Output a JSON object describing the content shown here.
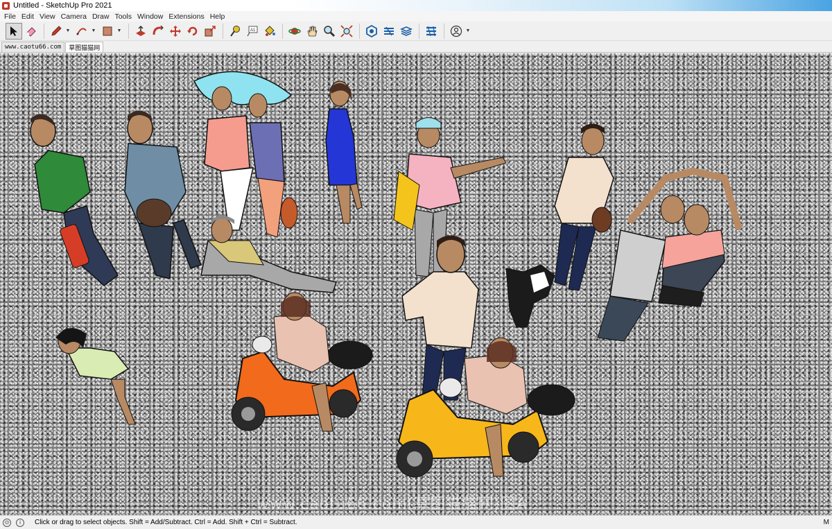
{
  "window": {
    "title": "Untitled - SketchUp Pro 2021"
  },
  "menu": [
    "File",
    "Edit",
    "View",
    "Camera",
    "Draw",
    "Tools",
    "Window",
    "Extensions",
    "Help"
  ],
  "tabs": [
    {
      "label": "www.caotu66.com",
      "active": false
    },
    {
      "label": "草图猫猫网",
      "active": true
    }
  ],
  "toolbar": {
    "tools": [
      {
        "name": "select-tool",
        "icon": "arrow-cursor-icon",
        "selected": true
      },
      {
        "name": "eraser-tool",
        "icon": "eraser-icon"
      },
      {
        "name": "line-tool",
        "icon": "pencil-icon",
        "dropdown": true
      },
      {
        "name": "arc-tool",
        "icon": "arc-icon",
        "dropdown": true
      },
      {
        "name": "rectangle-tool",
        "icon": "rectangle-icon",
        "dropdown": true
      },
      {
        "name": "push-pull-tool",
        "icon": "push-pull-icon"
      },
      {
        "name": "follow-me-tool",
        "icon": "follow-me-icon"
      },
      {
        "name": "move-tool",
        "icon": "move-icon"
      },
      {
        "name": "rotate-tool",
        "icon": "rotate-icon"
      },
      {
        "name": "scale-tool",
        "icon": "scale-icon"
      },
      {
        "name": "tape-measure-tool",
        "icon": "tape-measure-icon"
      },
      {
        "name": "text-tool",
        "icon": "text-icon"
      },
      {
        "name": "paint-bucket-tool",
        "icon": "paint-bucket-icon"
      },
      {
        "name": "orbit-tool",
        "icon": "orbit-icon"
      },
      {
        "name": "pan-tool",
        "icon": "pan-hand-icon"
      },
      {
        "name": "zoom-tool",
        "icon": "zoom-icon"
      },
      {
        "name": "zoom-extents-tool",
        "icon": "zoom-extents-icon"
      },
      {
        "name": "warehouse-tool",
        "icon": "3d-warehouse-icon"
      },
      {
        "name": "extension-warehouse-tool",
        "icon": "extension-warehouse-icon"
      },
      {
        "name": "layout-tool",
        "icon": "layout-icon"
      },
      {
        "name": "extension-manager-tool",
        "icon": "extension-manager-icon"
      },
      {
        "name": "account-tool",
        "icon": "account-icon",
        "dropdown": true
      }
    ],
    "text_tool_label": "A1"
  },
  "viewport": {
    "watermark": "www.caotu66.com(草图猫猫网)图A"
  },
  "status": {
    "hint": "Click or drag to select objects. Shift = Add/Subtract. Ctrl = Add. Shift + Ctrl = Subtract.",
    "right": "M"
  },
  "colors": {
    "umbrella": "#8fe3f0",
    "scooter_orange": "#f26a1b",
    "scooter_yellow": "#f7b71a",
    "skin": "#b88a63",
    "ground": "#7d7d7d"
  }
}
